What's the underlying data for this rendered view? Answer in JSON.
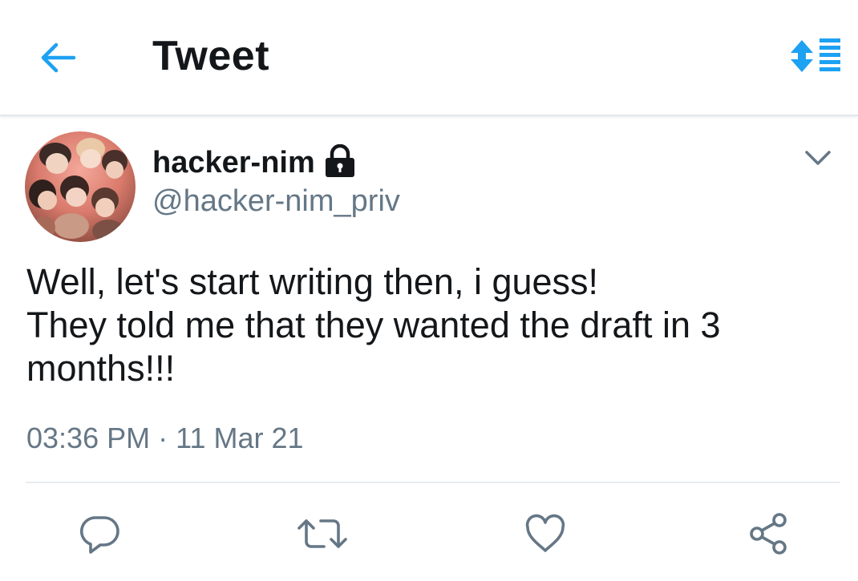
{
  "header": {
    "title": "Tweet",
    "back_icon": "arrow-left-icon",
    "sort_icon": "sort-list-icon"
  },
  "tweet": {
    "author": {
      "name": "hacker-nim",
      "handle": "@hacker-nim_priv",
      "protected_icon": "lock-icon"
    },
    "text": "Well, let's start writing then, i guess!\nThey told me that they wanted the draft in 3 months!!!",
    "time": "03:36 PM",
    "separator": "·",
    "date": "11 Mar 21"
  },
  "actions": [
    {
      "icon": "reply-icon"
    },
    {
      "icon": "retweet-icon"
    },
    {
      "icon": "like-icon"
    },
    {
      "icon": "share-icon"
    }
  ],
  "colors": {
    "accent": "#1da1f2",
    "text_primary": "#14171a",
    "text_secondary": "#657786",
    "divider": "#e6ecf0"
  }
}
